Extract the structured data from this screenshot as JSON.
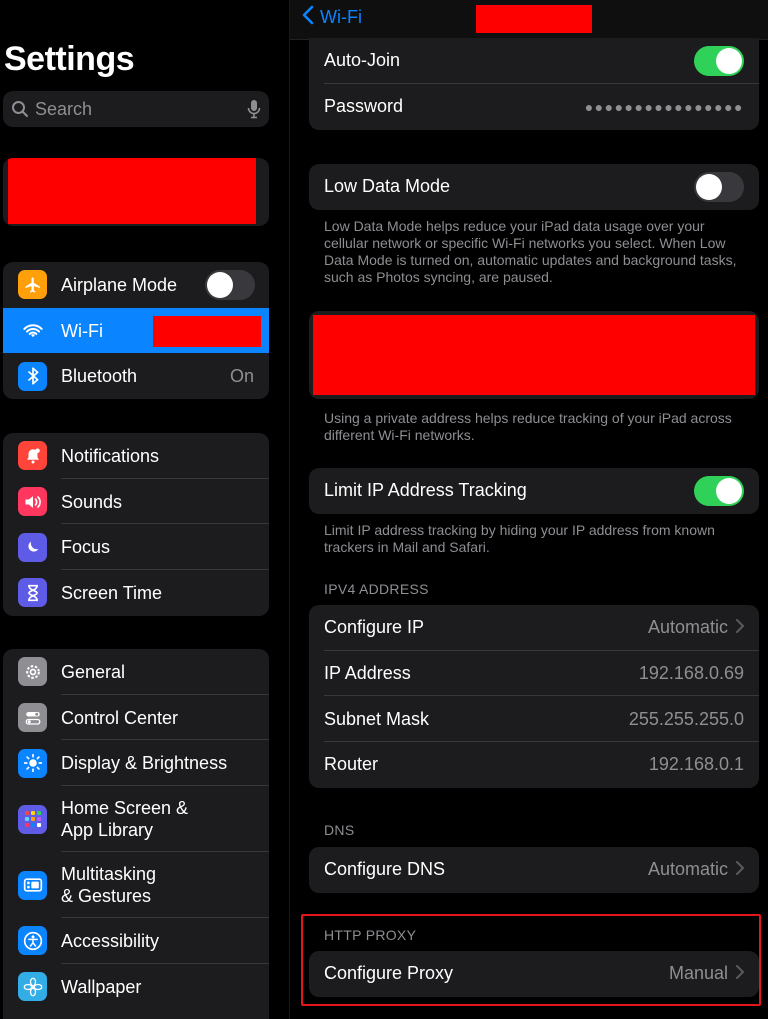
{
  "sidebar": {
    "title": "Settings",
    "search": {
      "placeholder": "Search",
      "icon": "magnifyingglass",
      "mic_icon": "mic"
    },
    "group1": [
      {
        "label": "Airplane Mode",
        "icon": "airplane",
        "color": "#ff9f0a",
        "toggle": "off"
      },
      {
        "label": "Wi-Fi",
        "icon": "wifi",
        "color": "#0a84ff",
        "selected": true
      },
      {
        "label": "Bluetooth",
        "icon": "bluetooth",
        "color": "#0a84ff",
        "value": "On"
      }
    ],
    "group2": [
      {
        "label": "Notifications",
        "icon": "bell",
        "color": "#ff453a"
      },
      {
        "label": "Sounds",
        "icon": "speaker",
        "color": "#ff375f"
      },
      {
        "label": "Focus",
        "icon": "moon",
        "color": "#5e5ce6"
      },
      {
        "label": "Screen Time",
        "icon": "hourglass",
        "color": "#5e5ce6"
      }
    ],
    "group3": [
      {
        "label": "General",
        "icon": "gear",
        "color": "#8e8e93"
      },
      {
        "label": "Control Center",
        "icon": "switches",
        "color": "#8e8e93"
      },
      {
        "label": "Display & Brightness",
        "icon": "sun",
        "color": "#0a84ff"
      },
      {
        "label_line1": "Home Screen &",
        "label_line2": "App Library",
        "icon": "app-grid",
        "color": "#5e5ce6"
      },
      {
        "label_line1": "Multitasking",
        "label_line2": "& Gestures",
        "icon": "multitask",
        "color": "#0a84ff"
      },
      {
        "label": "Accessibility",
        "icon": "accessibility",
        "color": "#0a84ff"
      },
      {
        "label": "Wallpaper",
        "icon": "flower",
        "color": "#32ade6"
      }
    ]
  },
  "detail": {
    "back_label": "Wi-Fi",
    "auto_join": {
      "label": "Auto-Join",
      "toggle": "on"
    },
    "password": {
      "label": "Password",
      "value": "●●●●●●●●●●●●●●●●"
    },
    "low_data": {
      "label": "Low Data Mode",
      "toggle": "off",
      "footnote": "Low Data Mode helps reduce your iPad data usage over your cellular network or specific Wi-Fi networks you select. When Low Data Mode is turned on, automatic updates and background tasks, such as Photos syncing, are paused."
    },
    "private_address_footnote": "Using a private address helps reduce tracking of your iPad across different Wi-Fi networks.",
    "limit_ip": {
      "label": "Limit IP Address Tracking",
      "toggle": "on",
      "footnote": "Limit IP address tracking by hiding your IP address from known trackers in Mail and Safari."
    },
    "ipv4": {
      "header": "IPV4 ADDRESS",
      "rows": [
        {
          "label": "Configure IP",
          "value": "Automatic",
          "chevron": true
        },
        {
          "label": "IP Address",
          "value": "192.168.0.69"
        },
        {
          "label": "Subnet Mask",
          "value": "255.255.255.0"
        },
        {
          "label": "Router",
          "value": "192.168.0.1"
        }
      ]
    },
    "dns": {
      "header": "DNS",
      "label": "Configure DNS",
      "value": "Automatic"
    },
    "proxy": {
      "header": "HTTP PROXY",
      "label": "Configure Proxy",
      "value": "Manual"
    }
  },
  "colors": {
    "accent": "#0a84ff",
    "toggle_on": "#30d158",
    "redaction": "#ff0000",
    "highlight_box": "#e8141b"
  }
}
